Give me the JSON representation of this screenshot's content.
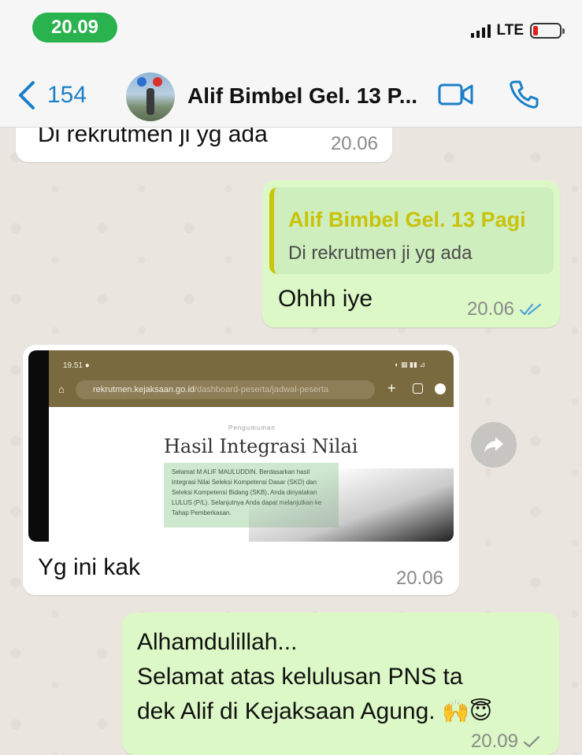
{
  "status_bar": {
    "time": "20.09",
    "network": "LTE"
  },
  "header": {
    "back_count": "154",
    "title": "Alif Bimbel Gel. 13 P..."
  },
  "messages": [
    {
      "direction": "incoming",
      "text": "Di rekrutmen ji yg ada",
      "time": "20.06"
    },
    {
      "direction": "outgoing",
      "quote": {
        "author": "Alif Bimbel Gel. 13 Pagi",
        "text": "Di rekrutmen ji yg ada"
      },
      "text": "Ohhh iye",
      "time": "20.06",
      "status": "read"
    },
    {
      "direction": "incoming",
      "image": {
        "phone_time": "19.51",
        "url_host": "rekrutmen.kejaksaan.go.id",
        "url_path": "/dashboard-peserta/jadwal-peserta",
        "label_small": "Pengumuman",
        "heading": "Hasil Integrasi Nilai",
        "body": "Selamat M ALIF MAULUDDIN. Berdasarkan hasil Integrasi Nilai Seleksi Kompetensi Dasar (SKD) dan Seleksi Kompetensi Bidang (SKB), Anda dinyatakan LULUS (P/L). Selanjutnya Anda dapat melanjutkan ke Tahap Pemberkasan."
      },
      "text": "Yg ini kak",
      "time": "20.06"
    },
    {
      "direction": "outgoing",
      "lines": [
        "Alhamdulillah...",
        "Selamat atas kelulusan PNS ta",
        "dek Alif di Kejaksaan Agung."
      ],
      "emojis": [
        "🙌",
        "😇"
      ],
      "time": "20.09",
      "status": "sent"
    }
  ],
  "colors": {
    "accent": "#1a7fc9",
    "time_pill": "#2ab24f",
    "outgoing_bubble": "#dcf8c6",
    "incoming_bubble": "#ffffff",
    "read_tick": "#4fa3e0",
    "quote_author": "#c9c20b"
  },
  "icons": [
    "back-chevron-icon",
    "video-call-icon",
    "phone-call-icon",
    "forward-icon",
    "read-ticks-icon",
    "sent-tick-icon"
  ]
}
